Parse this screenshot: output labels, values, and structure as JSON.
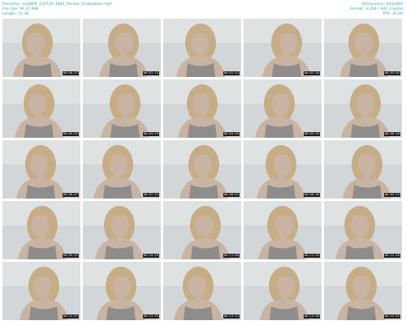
{
  "header": {
    "filename_label": "Filename:",
    "filename": "mad809_220726_1842_female_Chaturbate.mp4",
    "filesize_label": "File size:",
    "filesize": "94.37 MiB",
    "length_label": "Length:",
    "length": "15:38",
    "dimensions_label": "Dimensions:",
    "dimensions": "640x480",
    "format_label": "Format:",
    "format": "H.264 / AAC (mp4a)",
    "fps_label": "FPS:",
    "fps": "30.00"
  },
  "thumbnails": [
    {
      "time": "00:00:37"
    },
    {
      "time": "00:01:14"
    },
    {
      "time": "00:01:51"
    },
    {
      "time": "00:02:28"
    },
    {
      "time": "00:03:05"
    },
    {
      "time": "00:03:42"
    },
    {
      "time": "00:04:19"
    },
    {
      "time": "00:04:56"
    },
    {
      "time": "00:05:33"
    },
    {
      "time": "00:06:10"
    },
    {
      "time": "00:06:47"
    },
    {
      "time": "00:07:24"
    },
    {
      "time": "00:08:01"
    },
    {
      "time": "00:08:38"
    },
    {
      "time": "00:09:15"
    },
    {
      "time": "00:09:52"
    },
    {
      "time": "00:10:29"
    },
    {
      "time": "00:11:06"
    },
    {
      "time": "00:11:43"
    },
    {
      "time": "00:12:20"
    },
    {
      "time": "00:12:57"
    },
    {
      "time": "00:13:34"
    },
    {
      "time": "00:14:11"
    },
    {
      "time": "00:14:48"
    },
    {
      "time": "00:15:25"
    }
  ],
  "colors": {
    "header_text": "#3aa2a0",
    "wall": "#d3d6d8",
    "skin": "#c9b3a2",
    "hair": "#c6ad86",
    "top": "#8e8d8c",
    "timestamp_bg": "#1f1f1f"
  }
}
